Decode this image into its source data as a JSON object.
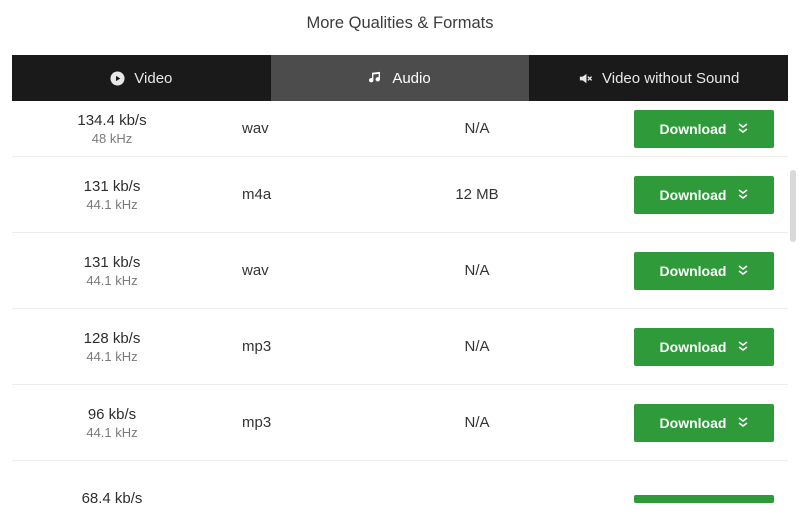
{
  "title": "More Qualities & Formats",
  "tabs": {
    "video": "Video",
    "audio": "Audio",
    "nosound": "Video without Sound"
  },
  "download_label": "Download",
  "rows": [
    {
      "bitrate": "134.4 kb/s",
      "samplerate": "48 kHz",
      "format": "wav",
      "size": "N/A"
    },
    {
      "bitrate": "131 kb/s",
      "samplerate": "44.1 kHz",
      "format": "m4a",
      "size": "12 MB"
    },
    {
      "bitrate": "131 kb/s",
      "samplerate": "44.1 kHz",
      "format": "wav",
      "size": "N/A"
    },
    {
      "bitrate": "128 kb/s",
      "samplerate": "44.1 kHz",
      "format": "mp3",
      "size": "N/A"
    },
    {
      "bitrate": "96 kb/s",
      "samplerate": "44.1 kHz",
      "format": "mp3",
      "size": "N/A"
    },
    {
      "bitrate": "68.4 kb/s",
      "samplerate": "",
      "format": "",
      "size": ""
    }
  ],
  "colors": {
    "accent": "#2e9a3a",
    "tab_bg": "#1a1a1a",
    "tab_active": "#4c4c4c"
  }
}
